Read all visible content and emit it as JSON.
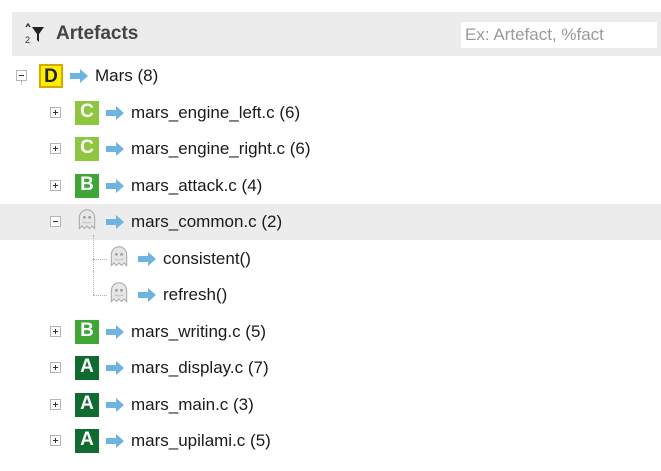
{
  "header": {
    "title": "Artefacts",
    "sort_icon": "sort-alpha-filter-icon",
    "filter_placeholder": "Ex: Artefact, %fact"
  },
  "tree": {
    "root": {
      "grade": "D",
      "grade_color": "#ffee00",
      "grade_text_color": "#222222",
      "label": "Mars (8)",
      "expanded": true
    },
    "children": [
      {
        "grade": "C",
        "grade_color": "#8ec63f",
        "grade_text_color": "#ffffff",
        "label": "mars_engine_left.c (6)",
        "expanded": false
      },
      {
        "grade": "C",
        "grade_color": "#8ec63f",
        "grade_text_color": "#ffffff",
        "label": "mars_engine_right.c (6)",
        "expanded": false
      },
      {
        "grade": "B",
        "grade_color": "#3fa535",
        "grade_text_color": "#ffffff",
        "label": "mars_attack.c (4)",
        "expanded": false
      },
      {
        "grade": "",
        "icon": "ghost-icon",
        "label": "mars_common.c (2)",
        "expanded": true,
        "selected": true,
        "children": [
          {
            "icon": "ghost-icon",
            "label": "consistent()"
          },
          {
            "icon": "ghost-icon",
            "label": "refresh()"
          }
        ]
      },
      {
        "grade": "B",
        "grade_color": "#3fa535",
        "grade_text_color": "#ffffff",
        "label": "mars_writing.c (5)",
        "expanded": false
      },
      {
        "grade": "A",
        "grade_color": "#0f6b2f",
        "grade_text_color": "#ffffff",
        "label": "mars_display.c (7)",
        "expanded": false
      },
      {
        "grade": "A",
        "grade_color": "#0f6b2f",
        "grade_text_color": "#ffffff",
        "label": "mars_main.c (3)",
        "expanded": false
      },
      {
        "grade": "A",
        "grade_color": "#0f6b2f",
        "grade_text_color": "#ffffff",
        "label": "mars_upilami.c (5)",
        "expanded": false
      }
    ],
    "arrow_icon": "arrow-right-icon",
    "arrow_color": "#6fb3e0"
  }
}
